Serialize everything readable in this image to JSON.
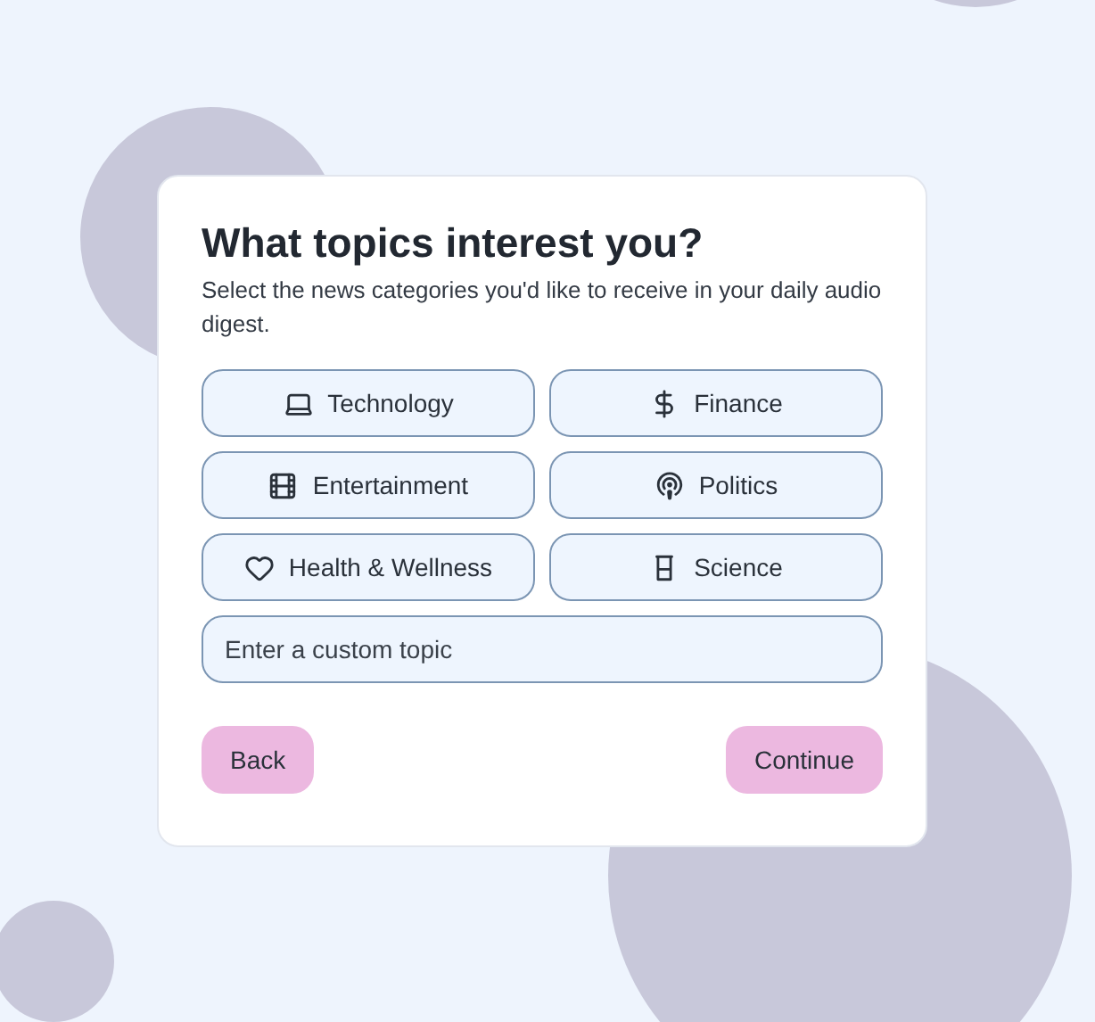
{
  "title": "What topics interest you?",
  "subtitle": "Select the news categories you'd like to receive in your daily audio digest.",
  "topics": [
    {
      "label": "Technology"
    },
    {
      "label": "Finance"
    },
    {
      "label": "Entertainment"
    },
    {
      "label": "Politics"
    },
    {
      "label": "Health & Wellness"
    },
    {
      "label": "Science"
    }
  ],
  "custom_topic": {
    "placeholder": "Enter a custom topic"
  },
  "buttons": {
    "back": "Back",
    "continue": "Continue"
  }
}
